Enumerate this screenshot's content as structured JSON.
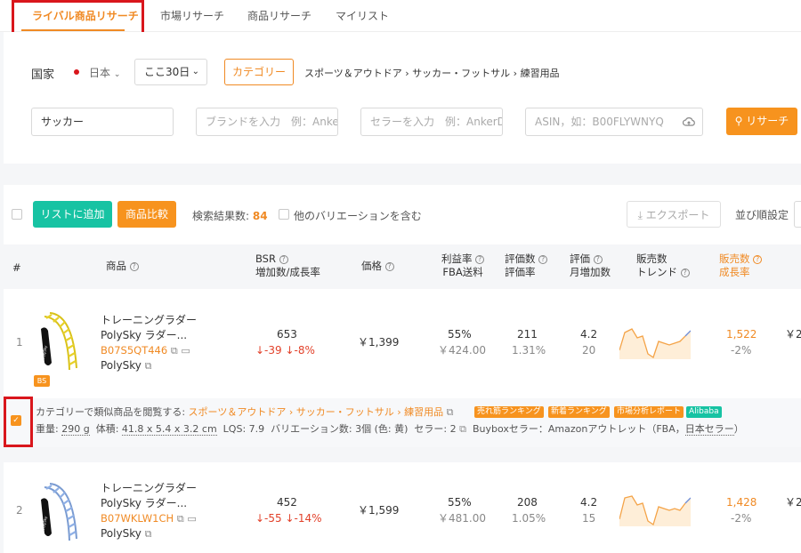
{
  "tabs": [
    "ライバル商品リサーチ",
    "市場リサーチ",
    "商品リサーチ",
    "マイリスト"
  ],
  "filters": {
    "country_label": "国家",
    "country_value": "日本",
    "period_value": "ここ30日",
    "category_button": "カテゴリー",
    "category_path": "スポーツ＆アウトドア › サッカー・フットサル › 練習用品",
    "keyword_value": "サッカー",
    "brand_placeholder": "ブランドを入力　例：Anke",
    "seller_placeholder": "セラーを入力　例：AnkerD",
    "asin_placeholder": "ASIN，如：B00FLYWNYQ",
    "search_button": "リサーチ"
  },
  "toolbar": {
    "add_to_list": "リストに追加",
    "compare": "商品比較",
    "result_label": "検索結果数:",
    "result_count": "84",
    "include_variations": "他のバリエーションを含む",
    "export": "エクスポート",
    "sort_label": "並び順設定"
  },
  "headers": {
    "index": "#",
    "product": "商品",
    "bsr_1": "BSR",
    "bsr_2": "増加数/成長率",
    "price": "価格",
    "profit_1": "利益率",
    "profit_2": "FBA送料",
    "reviews_1": "評価数",
    "reviews_2": "評価率",
    "rating_1": "評価",
    "rating_2": "月増加数",
    "trend_1": "販売数",
    "trend_2": "トレンド",
    "sales_1": "販売数",
    "sales_2": "成長率"
  },
  "products": [
    {
      "index": "1",
      "title": "トレーニングラダー",
      "subtitle": "PolySky ラダー...",
      "asin": "B07S5QT446",
      "brand": "PolySky",
      "badge": "BS",
      "bsr": "653",
      "bsr_change": "↓-39",
      "bsr_rate": "↓-8%",
      "price": "￥1,399",
      "profit": "55%",
      "fba": "￥424.00",
      "reviews": "211",
      "review_rate": "1.31%",
      "rating": "4.2",
      "rating_monthly": "20",
      "sales": "1,522",
      "sales_growth": "-2%",
      "next_col": "￥2"
    },
    {
      "index": "2",
      "title": "トレーニングラダー",
      "subtitle": "PolySky ラダー...",
      "asin": "B07WKLW1CH",
      "brand": "PolySky",
      "bsr": "452",
      "bsr_change": "↓-55",
      "bsr_rate": "↓-14%",
      "price": "￥1,599",
      "profit": "55%",
      "fba": "￥481.00",
      "reviews": "208",
      "review_rate": "1.05%",
      "rating": "4.2",
      "rating_monthly": "15",
      "sales": "1,428",
      "sales_growth": "-2%",
      "next_col": "￥2"
    }
  ],
  "detail": {
    "browse_label": "カテゴリーで類似商品を閲覧する:",
    "browse_path": "スポーツ＆アウトドア › サッカー・フットサル › 練習用品",
    "tags": [
      "売れ筋ランキング",
      "新着ランキング",
      "市場分析レポート",
      "Alibaba"
    ],
    "weight_label": "重量:",
    "weight_value": "290 g",
    "volume_label": "体積:",
    "volume_value": "41.8 x 5.4 x 3.2 cm",
    "lqs": "LQS: 7.9",
    "variations": "バリエーション数: 3個 (色: 黄)",
    "sellers": "セラー: 2",
    "buybox_label": "Buyboxセラー：Amazonアウトレット（FBA，",
    "buybox_country": "日本セラー",
    "buybox_end": "）"
  },
  "colors": {
    "accent": "#f08a24",
    "green": "#17c3a3",
    "red": "#e2412a",
    "highlight": "#d9161c"
  }
}
